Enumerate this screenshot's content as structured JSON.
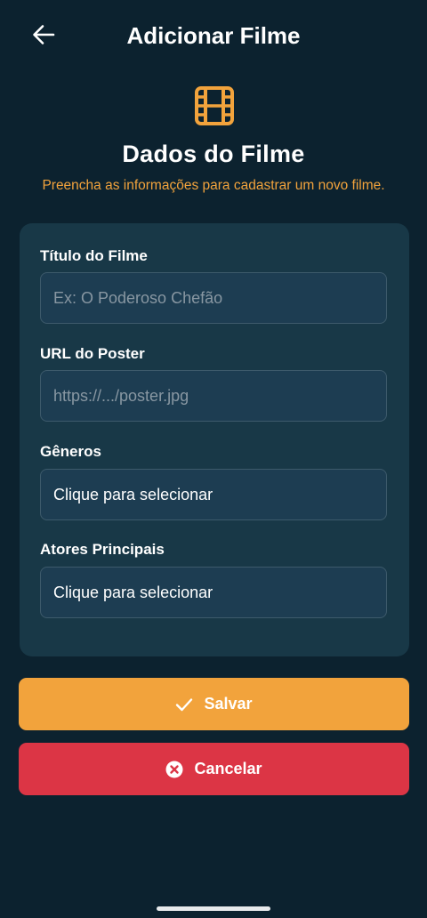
{
  "header": {
    "title": "Adicionar Filme",
    "back_icon": "arrow-left-icon"
  },
  "hero": {
    "icon": "film-icon",
    "title": "Dados do Filme",
    "subtitle": "Preencha as informações para cadastrar um novo filme."
  },
  "form": {
    "fields": [
      {
        "label": "Título do Filme",
        "value": "",
        "placeholder": "Ex: O Poderoso Chefão"
      },
      {
        "label": "URL do Poster",
        "value": "",
        "placeholder": "https://.../poster.jpg"
      },
      {
        "label": "Gêneros",
        "value": "Clique para selecionar"
      },
      {
        "label": "Atores Principais",
        "value": "Clique para selecionar"
      }
    ]
  },
  "actions": {
    "save_label": "Salvar",
    "save_icon": "check-icon",
    "cancel_label": "Cancelar",
    "cancel_icon": "x-circle-icon"
  },
  "colors": {
    "background": "#0c222f",
    "card": "#183847",
    "accent": "#f2a33c",
    "danger": "#dc3545"
  }
}
